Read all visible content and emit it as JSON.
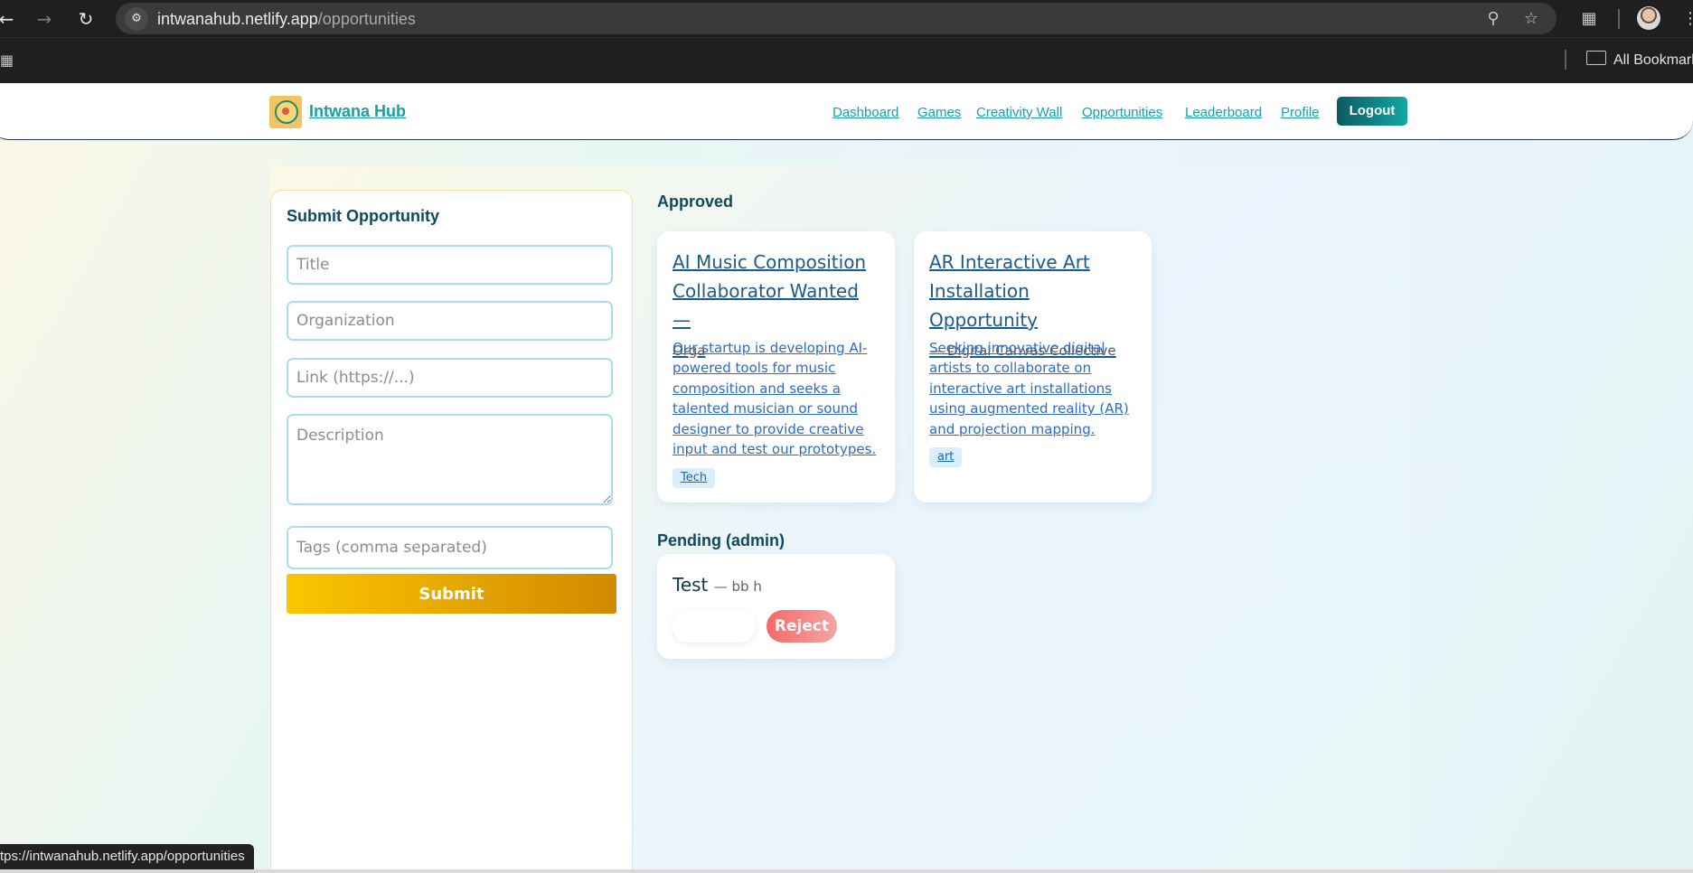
{
  "browser": {
    "url_host": "intwanahub.netlify.app",
    "url_path": "/opportunities",
    "bookmarks_label": "All Bookmark",
    "status_url": "tps://intwanahub.netlify.app/opportunities"
  },
  "header": {
    "brand": "Intwana Hub",
    "nav": [
      "Dashboard",
      "Games",
      "Creativity Wall",
      "Opportunities",
      "Leaderboard",
      "Profile"
    ],
    "logout_label": "Logout"
  },
  "form": {
    "title": "Submit Opportunity",
    "title_placeholder": "Title",
    "organization_placeholder": "Organization",
    "link_placeholder": "Link (https://...)",
    "description_placeholder": "Description",
    "tags_placeholder": "Tags (comma separated)",
    "submit_label": "Submit"
  },
  "approved": {
    "heading": "Approved",
    "cards": [
      {
        "title_lines": [
          "AI Music Composition",
          "Collaborator Wanted"
        ],
        "dash": " —",
        "org": "Orga",
        "description": "Our startup is developing AI-powered tools for music composition and seeks a talented musician or sound designer to provide creative input and test our prototypes.",
        "tag": "Tech"
      },
      {
        "title_lines": [
          "AR Interactive Art",
          "Installation Opportunity"
        ],
        "dash": "—",
        "org": "Digital Canvas Collective",
        "description": "Seeking innovative digital artists to collaborate on interactive art installations using augmented reality (AR) and projection mapping.",
        "tag": "art"
      }
    ]
  },
  "pending": {
    "heading": "Pending (admin)",
    "item": {
      "title": "Test",
      "org": "— bb h",
      "approve_label": "",
      "reject_label": "Reject"
    }
  },
  "colors": {
    "accent": "#13a7a7",
    "brand_dark": "#0f4a5c",
    "submit": "#fbc600",
    "reject": "#f36a6a"
  }
}
